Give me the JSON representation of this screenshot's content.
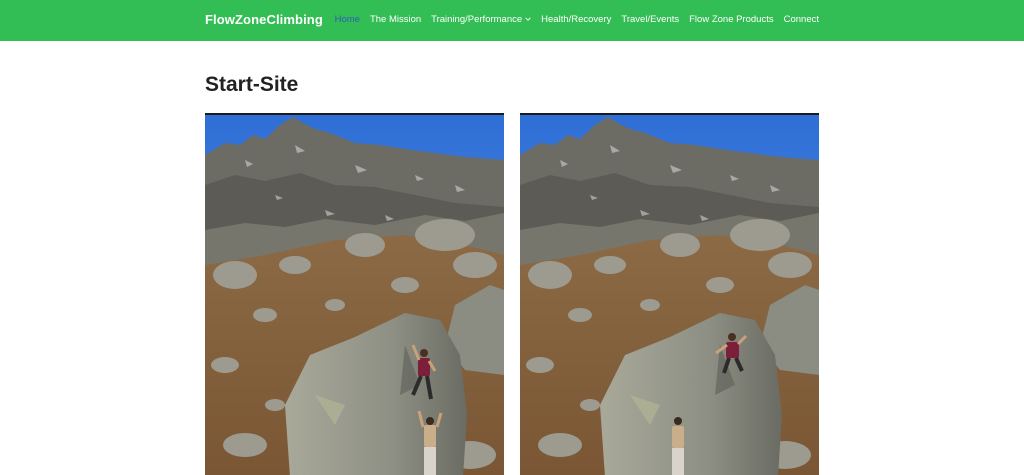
{
  "site": {
    "brand": "FlowZoneClimbing"
  },
  "nav": {
    "items": [
      {
        "label": "Home",
        "active": true
      },
      {
        "label": "The Mission"
      },
      {
        "label": "Training/Performance",
        "has_dropdown": true
      },
      {
        "label": "Health/Recovery"
      },
      {
        "label": "Travel/Events"
      },
      {
        "label": "Flow Zone Products"
      },
      {
        "label": "Connect"
      }
    ]
  },
  "main": {
    "title": "Start-Site"
  },
  "icons": {
    "dropdown": "chevron-down-icon"
  },
  "colors": {
    "header_bg": "#33bd55",
    "active_link": "#2c5fb8",
    "header_text": "#ffffff",
    "title_text": "#222222"
  }
}
